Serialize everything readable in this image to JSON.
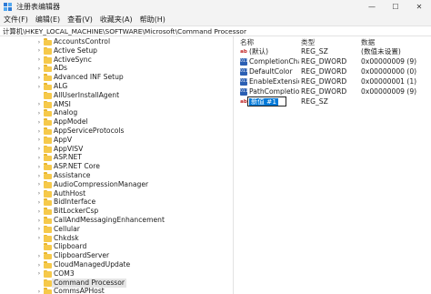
{
  "window": {
    "title": "注册表编辑器",
    "minimize_icon": "minimize-icon",
    "maximize_icon": "maximize-icon",
    "close_icon": "close-icon"
  },
  "menu": [
    "文件(F)",
    "编辑(E)",
    "查看(V)",
    "收藏夹(A)",
    "帮助(H)"
  ],
  "address": "计算机\\HKEY_LOCAL_MACHINE\\SOFTWARE\\Microsoft\\Command Processor",
  "tree": [
    {
      "label": "AccountsControl",
      "expandable": true
    },
    {
      "label": "Active Setup",
      "expandable": true
    },
    {
      "label": "ActiveSync",
      "expandable": true
    },
    {
      "label": "ADs",
      "expandable": true
    },
    {
      "label": "Advanced INF Setup",
      "expandable": true
    },
    {
      "label": "ALG",
      "expandable": true
    },
    {
      "label": "AllUserInstallAgent",
      "expandable": false
    },
    {
      "label": "AMSI",
      "expandable": true
    },
    {
      "label": "Analog",
      "expandable": true
    },
    {
      "label": "AppModel",
      "expandable": true
    },
    {
      "label": "AppServiceProtocols",
      "expandable": true
    },
    {
      "label": "AppV",
      "expandable": true
    },
    {
      "label": "AppVISV",
      "expandable": true
    },
    {
      "label": "ASP.NET",
      "expandable": true
    },
    {
      "label": "ASP.NET Core",
      "expandable": true
    },
    {
      "label": "Assistance",
      "expandable": true
    },
    {
      "label": "AudioCompressionManager",
      "expandable": true
    },
    {
      "label": "AuthHost",
      "expandable": true
    },
    {
      "label": "BidInterface",
      "expandable": true
    },
    {
      "label": "BitLockerCsp",
      "expandable": true
    },
    {
      "label": "CallAndMessagingEnhancement",
      "expandable": true
    },
    {
      "label": "Cellular",
      "expandable": true
    },
    {
      "label": "Chkdsk",
      "expandable": true
    },
    {
      "label": "Clipboard",
      "expandable": false
    },
    {
      "label": "ClipboardServer",
      "expandable": true
    },
    {
      "label": "CloudManagedUpdate",
      "expandable": true
    },
    {
      "label": "COM3",
      "expandable": true
    },
    {
      "label": "Command Processor",
      "expandable": false,
      "selected": true
    },
    {
      "label": "CommsAPHost",
      "expandable": true
    }
  ],
  "columns": {
    "name": "名称",
    "type": "类型",
    "data": "数据"
  },
  "values": [
    {
      "icon": "string-value-icon",
      "name": "(默认)",
      "type": "REG_SZ",
      "data": "(数值未设置)"
    },
    {
      "icon": "dword-value-icon",
      "name": "CompletionChar",
      "type": "REG_DWORD",
      "data": "0x00000009 (9)"
    },
    {
      "icon": "dword-value-icon",
      "name": "DefaultColor",
      "type": "REG_DWORD",
      "data": "0x00000000 (0)"
    },
    {
      "icon": "dword-value-icon",
      "name": "EnableExtensions",
      "type": "REG_DWORD",
      "data": "0x00000001 (1)"
    },
    {
      "icon": "dword-value-icon",
      "name": "PathCompletionChar",
      "type": "REG_DWORD",
      "data": "0x00000009 (9)"
    },
    {
      "icon": "string-value-icon",
      "name": "新值 #1",
      "type": "REG_SZ",
      "data": "",
      "editing": true
    }
  ]
}
